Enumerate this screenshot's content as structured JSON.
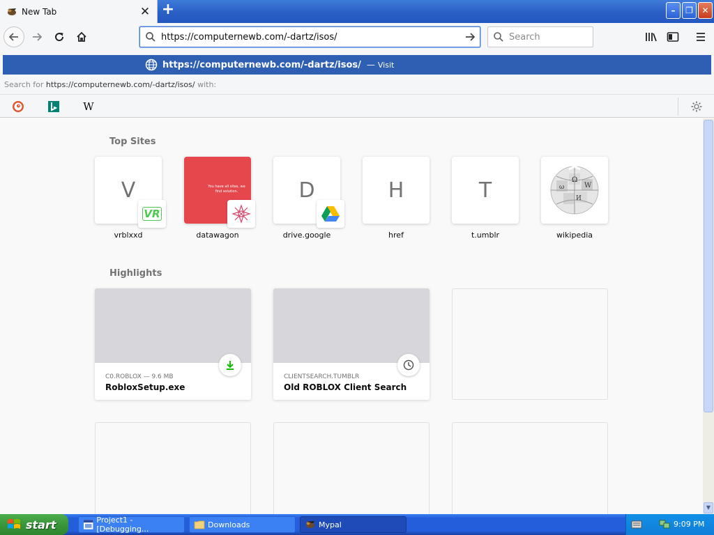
{
  "browser": {
    "tab": {
      "title": "New Tab"
    },
    "nav": {
      "url": "https://computernewb.com/-dartz/isos/",
      "search_placeholder": "Search"
    },
    "autocomplete": {
      "url": "https://computernewb.com/-dartz/isos/",
      "separator": "—",
      "action": "Visit",
      "search_for_prefix": "Search for",
      "search_for_query": "https://computernewb.com/-dartz/isos/",
      "search_for_suffix": "with:",
      "engines": [
        "duckduckgo-icon",
        "bing-icon",
        "wikipedia-icon"
      ],
      "wiki_glyph": "W"
    }
  },
  "newtab": {
    "top_sites_title": "Top Sites",
    "top_sites": [
      {
        "letter": "V",
        "label": "vrblxxd",
        "badge_text": "VR"
      },
      {
        "letter": "",
        "label": "datawagon",
        "screenshot_text": "You have all sites, we find solution."
      },
      {
        "letter": "D",
        "label": "drive.google"
      },
      {
        "letter": "H",
        "label": "href"
      },
      {
        "letter": "T",
        "label": "t.umblr"
      },
      {
        "letter": "",
        "label": "wikipedia"
      }
    ],
    "highlights_title": "Highlights",
    "highlights": [
      {
        "source": "C0.ROBLOX — 9.6 MB",
        "title": "RobloxSetup.exe",
        "icon": "download-icon"
      },
      {
        "source": "CLIENTSEARCH.TUMBLR",
        "title": "Old ROBLOX Client Search",
        "icon": "clock-icon"
      }
    ]
  },
  "taskbar": {
    "start": "start",
    "tasks": [
      {
        "label": "Project1 - [Debugging..."
      },
      {
        "label": "Downloads"
      },
      {
        "label": "Mypal"
      }
    ],
    "clock": "9:09 PM"
  },
  "colors": {
    "accent": "#2f5fb3",
    "titlebar": "#2a5fc4",
    "start_green": "#3a963a",
    "download_green": "#12bc00"
  }
}
